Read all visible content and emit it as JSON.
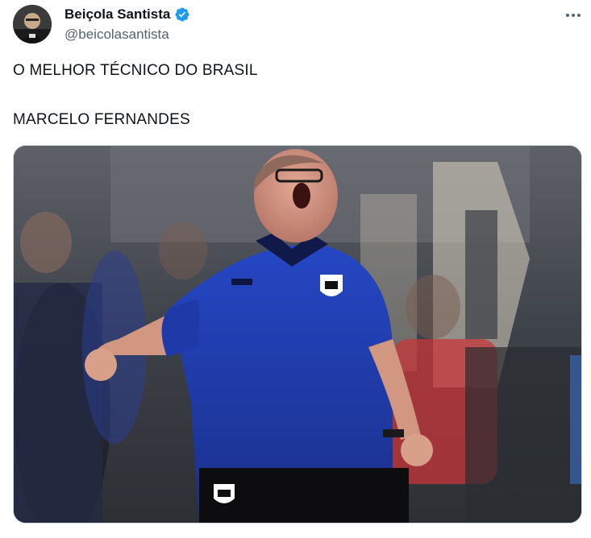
{
  "author": {
    "display_name": "Beiçola Santista",
    "handle": "@beicolasantista",
    "verified": true,
    "avatar_icon": "avatar-photo"
  },
  "tweet": {
    "lines": [
      "O MELHOR TÉCNICO DO BRASIL",
      "MARCELO FERNANDES"
    ]
  },
  "icons": {
    "more": "more-options-icon",
    "verified": "verified-badge-icon"
  },
  "colors": {
    "verified_blue": "#1d9bf0",
    "text_primary": "#0f1419",
    "text_secondary": "#536471",
    "shirt_blue": "#1f3fb5"
  }
}
